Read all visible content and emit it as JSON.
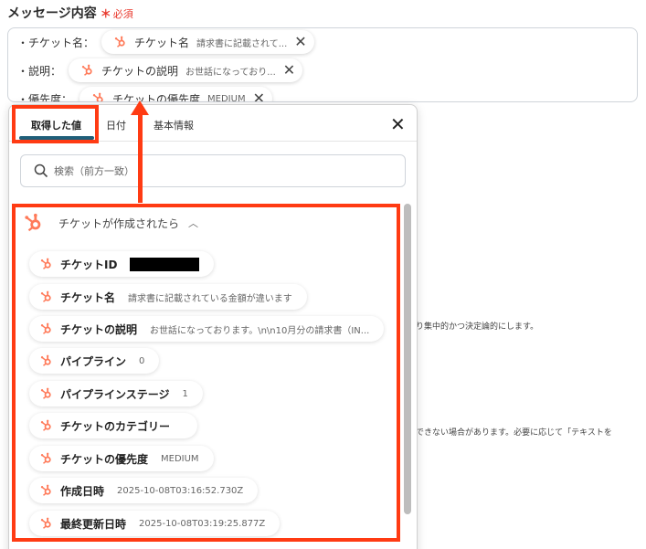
{
  "field": {
    "label": "メッセージ内容",
    "required_star": "＊",
    "required_text": "必須"
  },
  "message_lines": [
    {
      "label": "・チケット名：",
      "chip_name": "チケット名",
      "chip_value": "請求書に記載されて..."
    },
    {
      "label": "・説明：",
      "chip_name": "チケットの説明",
      "chip_value": "お世話になっており..."
    },
    {
      "label": "・優先度：",
      "chip_name": "チケットの優先度",
      "chip_value": "MEDIUM"
    }
  ],
  "background_texts": [
    "り集中的かつ決定論的にします。",
    "できない場合があります。必要に応じて「テキストを"
  ],
  "popup": {
    "tabs": [
      "取得した値",
      "日付",
      "基本情報"
    ],
    "search_placeholder": "検索（前方一致）",
    "group_title": "チケットが作成されたら",
    "items": [
      {
        "name": "チケットID",
        "value": "",
        "redacted": true
      },
      {
        "name": "チケット名",
        "value": "請求書に記載されている金額が違います"
      },
      {
        "name": "チケットの説明",
        "value": "お世話になっております。\\n\\n10月分の請求書（IN..."
      },
      {
        "name": "パイプライン",
        "value": "0"
      },
      {
        "name": "パイプラインステージ",
        "value": "1"
      },
      {
        "name": "チケットのカテゴリー",
        "value": ""
      },
      {
        "name": "チケットの優先度",
        "value": "MEDIUM"
      },
      {
        "name": "作成日時",
        "value": "2025-10-08T03:16:52.730Z"
      },
      {
        "name": "最終更新日時",
        "value": "2025-10-08T03:19:25.877Z"
      }
    ]
  },
  "colors": {
    "hubspot_orange": "#ff7a59",
    "highlight_red": "#ff3b13",
    "tab_underline": "#1f5f7a"
  },
  "icons": [
    "hubspot-icon",
    "close-icon",
    "search-icon",
    "chevron-up-icon"
  ]
}
